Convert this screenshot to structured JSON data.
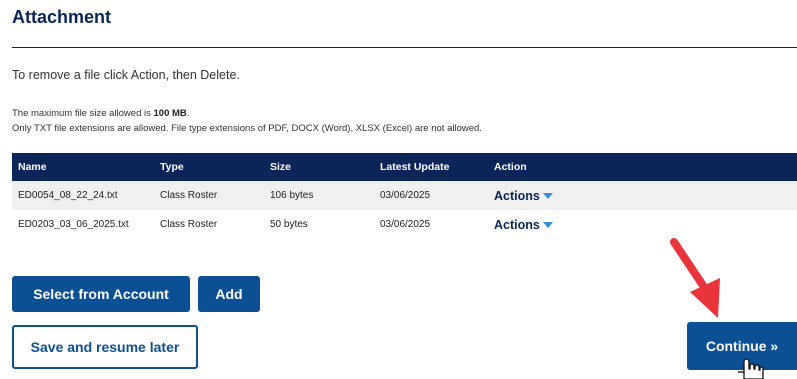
{
  "section": {
    "title": "Attachment",
    "instruction": "To remove a file click Action, then Delete.",
    "note_prefix": "The maximum file size allowed is ",
    "note_size": "100 MB",
    "note_suffix": ".",
    "note_types": "Only TXT file extensions are allowed. File type extensions of PDF, DOCX (Word), XLSX (Excel) are not allowed."
  },
  "table": {
    "headers": {
      "name": "Name",
      "type": "Type",
      "size": "Size",
      "latest_update": "Latest Update",
      "action": "Action"
    },
    "rows": [
      {
        "name": "ED0054_08_22_24.txt",
        "type": "Class Roster",
        "size": "106 bytes",
        "latest_update": "03/06/2025",
        "action": "Actions"
      },
      {
        "name": "ED0203_03_06_2025.txt",
        "type": "Class Roster",
        "size": "50 bytes",
        "latest_update": "03/06/2025",
        "action": "Actions"
      }
    ]
  },
  "buttons": {
    "select_from_account": "Select from Account",
    "add": "Add",
    "save_and_resume": "Save and resume later",
    "continue": "Continue »"
  },
  "icons": {
    "action_caret": "caret-down-icon",
    "annotation_arrow": "red-arrow-icon",
    "pointer_cursor": "hand-cursor-icon"
  },
  "colors": {
    "navy": "#0b2559",
    "button_blue": "#0b4f94",
    "caret_blue": "#2e8fd6",
    "arrow_red": "#e8343a"
  }
}
